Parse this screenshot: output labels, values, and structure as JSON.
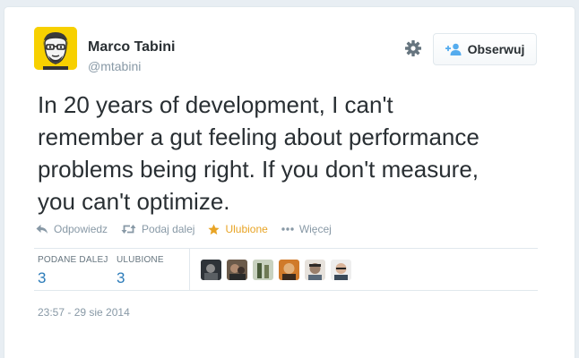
{
  "author": {
    "name": "Marco Tabini",
    "handle": "@mtabini"
  },
  "follow_button": {
    "label": "Obserwuj",
    "icon": "add-person-icon"
  },
  "settings_icon": "gear-icon",
  "tweet": {
    "lines": [
      "In 20 years of development, I can't",
      "remember a gut feeling about performance",
      "problems being right. If you don't measure,",
      "you can't optimize."
    ]
  },
  "actions": {
    "reply": "Odpowiedz",
    "retweet": "Podaj dalej",
    "favorite": "Ulubione",
    "more": "Więcej"
  },
  "stats": {
    "retweets_label": "PODANE DALEJ",
    "retweets_count": "3",
    "favorites_label": "ULUBIONE",
    "favorites_count": "3"
  },
  "favoriter_avatar_count": 6,
  "timestamp": "23:57 - 29 sie 2014",
  "colors": {
    "text": "#292f33",
    "muted": "#8899a6",
    "link": "#2b7bb9",
    "favorite": "#e8a425",
    "avatar_bg": "#f7d000",
    "border": "#e1e8ed"
  }
}
